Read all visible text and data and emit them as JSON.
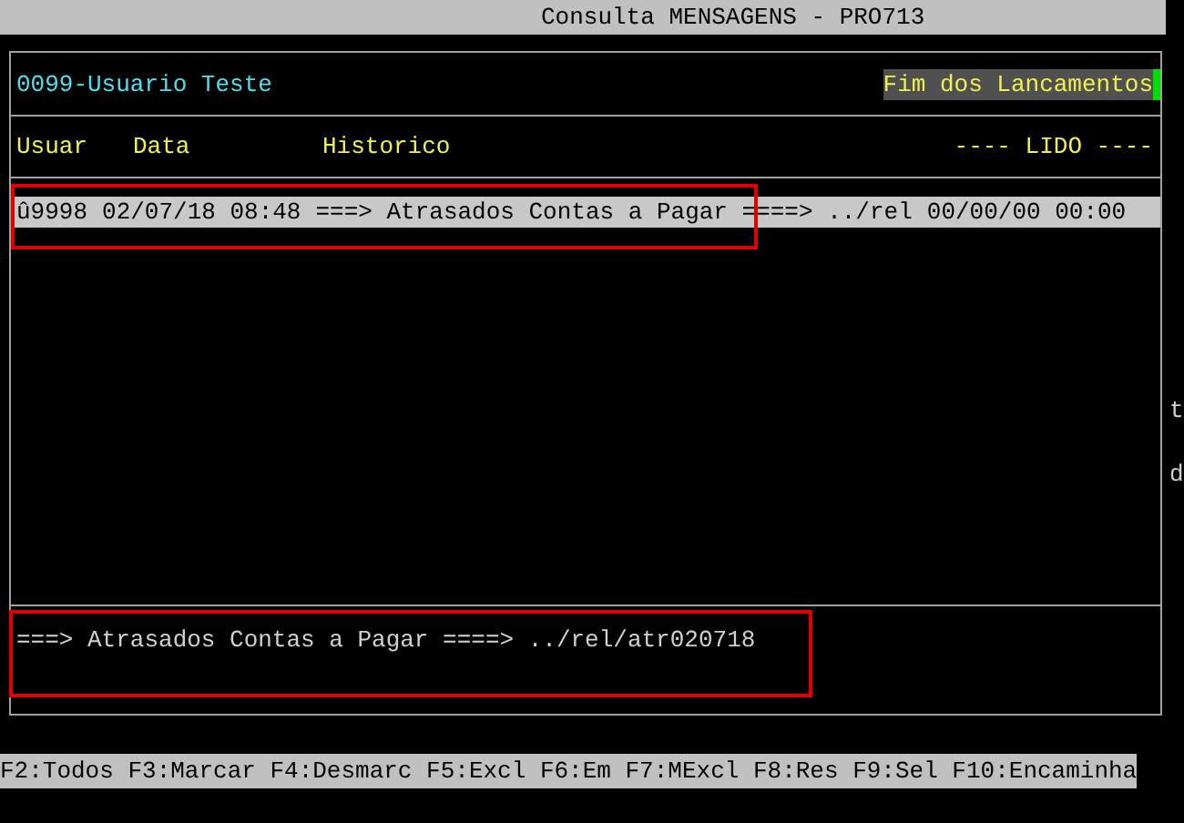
{
  "window": {
    "title": "Consulta MENSAGENS - PRO713"
  },
  "header": {
    "user": "0099-Usuario Teste",
    "status": "Fim dos Lancamentos"
  },
  "columns": [
    "Usuar",
    "Data",
    "Historico",
    "---- LIDO ----"
  ],
  "rows": [
    {
      "user": "û9998",
      "date": "02/07/18 08:48",
      "history": "===> Atrasados Contas a Pagar ====> ../rel",
      "read": "00/00/00 00:00",
      "selected": true
    }
  ],
  "detail": "===> Atrasados Contas a Pagar ====> ../rel/atr020718",
  "side_letters": [
    "t",
    "d"
  ],
  "function_keys": "F2:Todos F3:Marcar F4:Desmarc F5:Excl F6:Em F7:MExcl F8:Res F9:Sel F10:Encaminha"
}
